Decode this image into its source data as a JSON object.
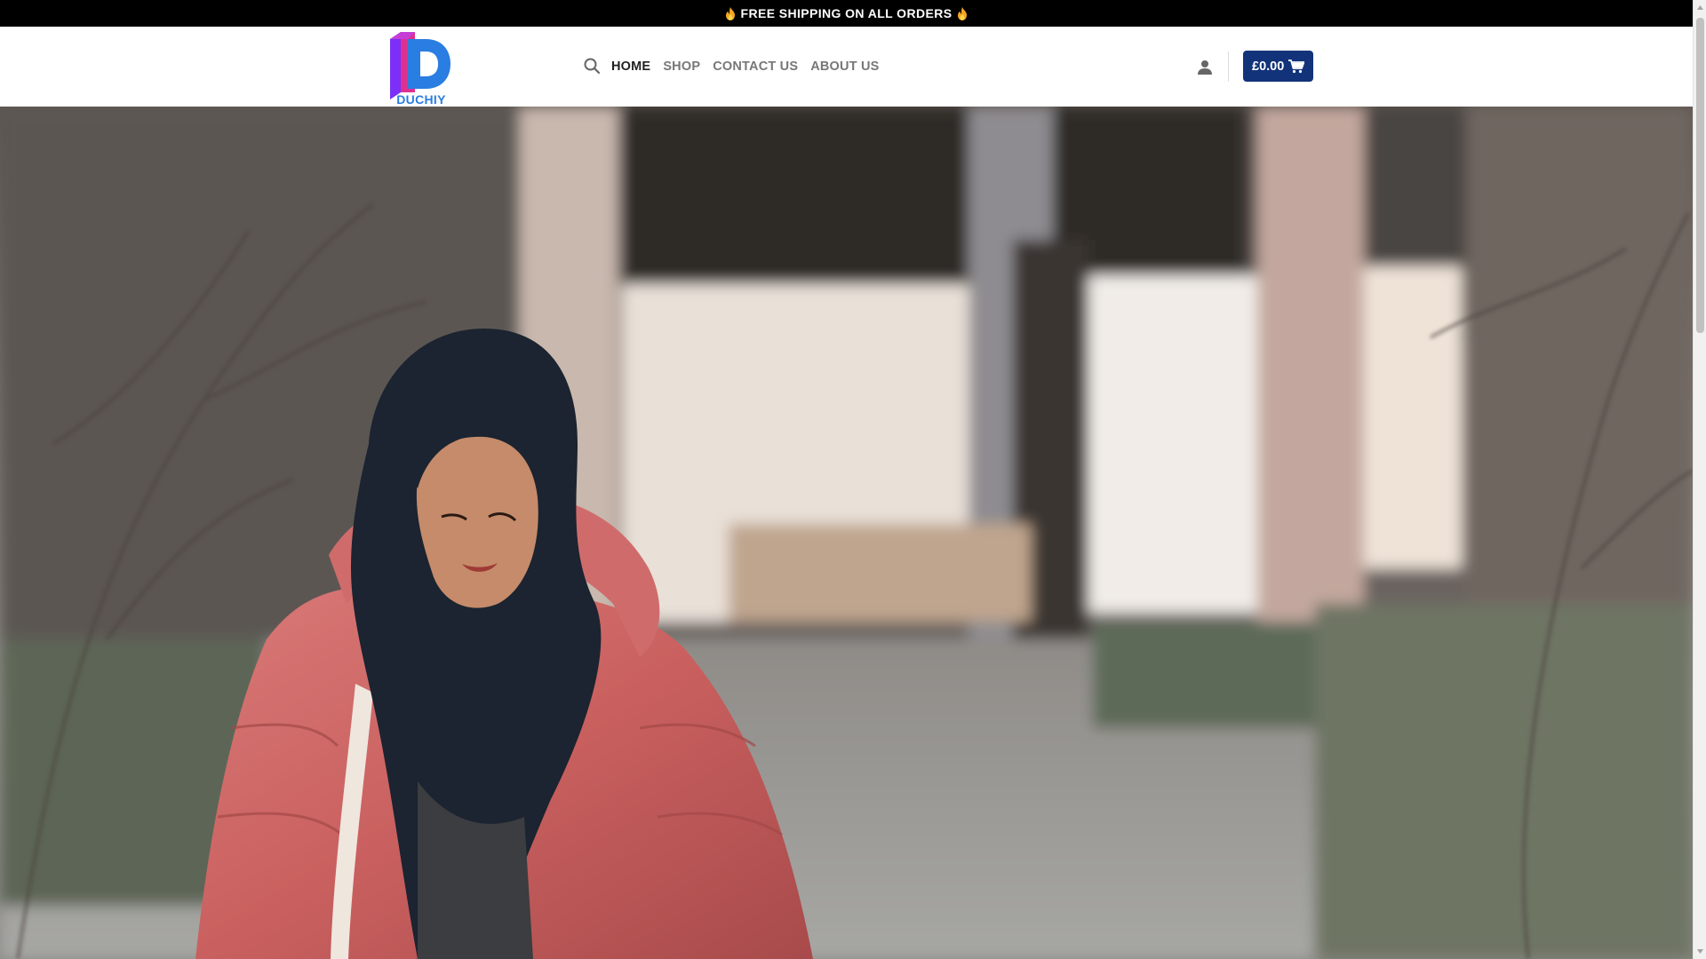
{
  "announcement": {
    "text": "FREE SHIPPING ON ALL ORDERS",
    "icon": "fire-icon"
  },
  "header": {
    "logo_text": "DUCHIY",
    "nav": [
      {
        "label": "HOME",
        "active": true
      },
      {
        "label": "SHOP",
        "active": false
      },
      {
        "label": "CONTACT US",
        "active": false
      },
      {
        "label": "ABOUT US",
        "active": false
      }
    ],
    "cart_label": "£0.00",
    "icons": [
      "search-icon",
      "account-icon",
      "cart-icon"
    ]
  },
  "colors": {
    "topbar_bg": "#000000",
    "cart_bg": "#12337a",
    "nav_active": "#222222",
    "nav_inactive": "#777777",
    "logo_blue": "#2a7de1"
  }
}
